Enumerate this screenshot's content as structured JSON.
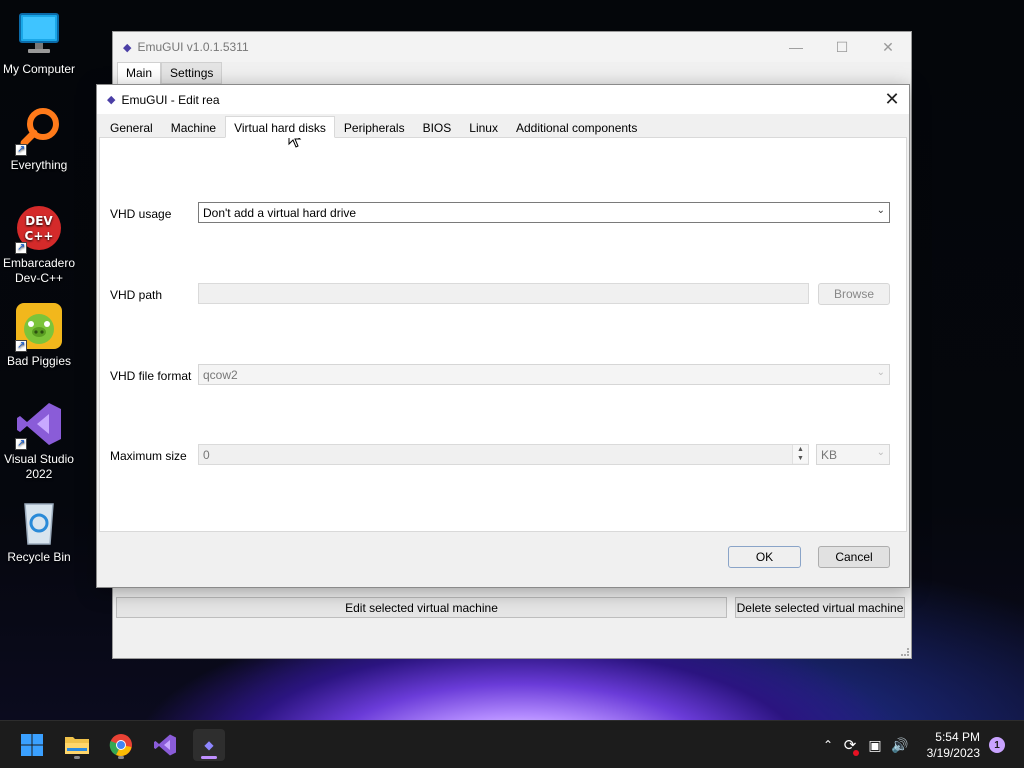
{
  "desktop": {
    "icons": [
      {
        "label": "My Computer"
      },
      {
        "label": "Everything"
      },
      {
        "label": "Embarcadero Dev-C++"
      },
      {
        "label": "Bad Piggies"
      },
      {
        "label": "Visual Studio 2022"
      },
      {
        "label": "Recycle Bin"
      }
    ]
  },
  "main_window": {
    "title": "EmuGUI v1.0.1.5311",
    "menu": [
      "Main",
      "Settings"
    ],
    "edit_button": "Edit selected virtual machine",
    "delete_button": "Delete selected virtual machine"
  },
  "dialog": {
    "title": "EmuGUI - Edit rea",
    "tabs": [
      "General",
      "Machine",
      "Virtual hard disks",
      "Peripherals",
      "BIOS",
      "Linux",
      "Additional components"
    ],
    "active_tab": "Virtual hard disks",
    "vhd_usage": {
      "label": "VHD usage",
      "value": "Don't add a virtual hard drive"
    },
    "vhd_path": {
      "label": "VHD path",
      "value": "",
      "browse": "Browse"
    },
    "vhd_format": {
      "label": "VHD file format",
      "value": "qcow2"
    },
    "max_size": {
      "label": "Maximum size",
      "value": "0",
      "unit": "KB"
    },
    "ok": "OK",
    "cancel": "Cancel"
  },
  "taskbar": {
    "time": "5:54 PM",
    "date": "3/19/2023",
    "notification_count": "1"
  }
}
